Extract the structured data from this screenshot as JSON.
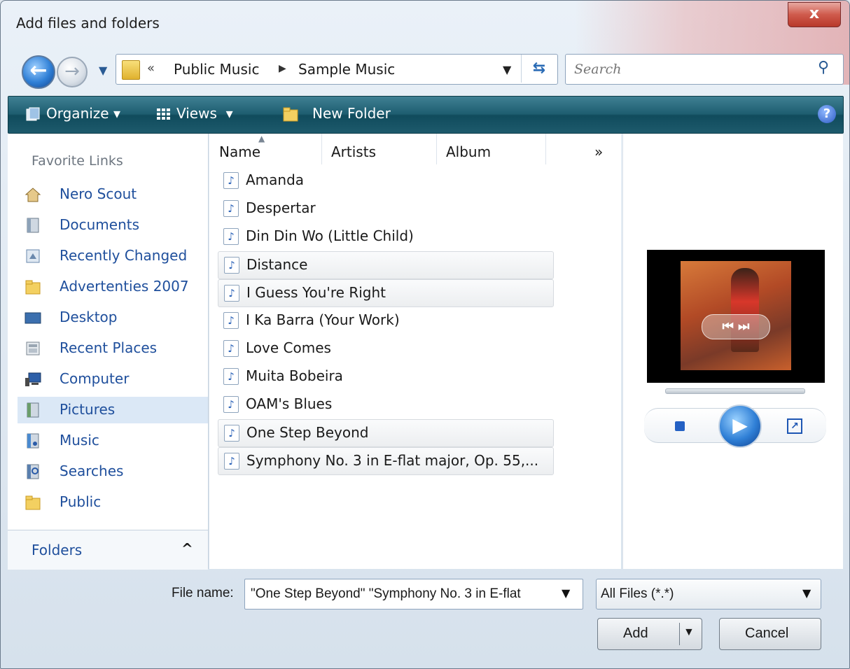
{
  "window": {
    "title": "Add files and folders",
    "close_label": "x"
  },
  "nav": {
    "breadcrumb_prefix": "«",
    "path": [
      "Public Music",
      "Sample Music"
    ],
    "search_placeholder": "Search"
  },
  "toolbar": {
    "organize_label": "Organize",
    "views_label": "Views",
    "new_folder_label": "New Folder",
    "help_label": "?"
  },
  "sidebar": {
    "favorites_header": "Favorite Links",
    "items": [
      {
        "label": "Nero Scout",
        "icon": "nero-scout-icon"
      },
      {
        "label": "Documents",
        "icon": "documents-icon"
      },
      {
        "label": "Recently Changed",
        "icon": "recently-changed-icon"
      },
      {
        "label": "Advertenties 2007",
        "icon": "folder-icon"
      },
      {
        "label": "Desktop",
        "icon": "desktop-icon"
      },
      {
        "label": "Recent Places",
        "icon": "recent-places-icon"
      },
      {
        "label": "Computer",
        "icon": "computer-icon"
      },
      {
        "label": "Pictures",
        "icon": "pictures-icon",
        "selected": true
      },
      {
        "label": "Music",
        "icon": "music-icon"
      },
      {
        "label": "Searches",
        "icon": "searches-icon"
      },
      {
        "label": "Public",
        "icon": "folder-icon"
      }
    ],
    "folders_label": "Folders",
    "folders_chevron": "^"
  },
  "filelist": {
    "columns": [
      "Name",
      "Artists",
      "Album"
    ],
    "more_columns": "»",
    "files": [
      {
        "name": "Amanda",
        "selected": false
      },
      {
        "name": "Despertar",
        "selected": false
      },
      {
        "name": "Din Din Wo (Little Child)",
        "selected": false
      },
      {
        "name": "Distance",
        "selected": true
      },
      {
        "name": "I Guess You're Right",
        "selected": true
      },
      {
        "name": "I Ka Barra (Your Work)",
        "selected": false
      },
      {
        "name": "Love Comes",
        "selected": false
      },
      {
        "name": "Muita Bobeira",
        "selected": false
      },
      {
        "name": "OAM's Blues",
        "selected": false
      },
      {
        "name": "One Step Beyond",
        "selected": true
      },
      {
        "name": "Symphony No. 3 in E-flat major, Op. 55,...",
        "selected": true
      }
    ]
  },
  "preview": {
    "play_label": "▶",
    "expand_label": "↗"
  },
  "footer": {
    "filename_label": "File name:",
    "filename_value": "\"One Step Beyond\" \"Symphony No. 3 in E-flat",
    "filetype_value": "All Files (*.*)",
    "add_label": "Add",
    "cancel_label": "Cancel"
  },
  "colors": {
    "toolbar_teal": "#1e5d70",
    "link_blue": "#1f4f9c",
    "selection": "#dbe8f6"
  }
}
